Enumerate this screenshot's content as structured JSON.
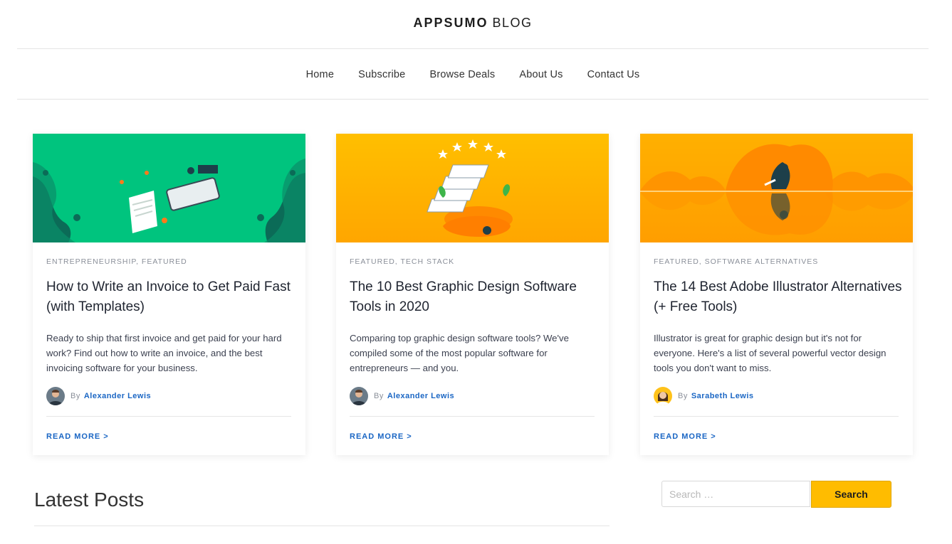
{
  "header": {
    "brand": "APPSUMO",
    "blog": "BLOG"
  },
  "nav": {
    "items": [
      {
        "label": "Home"
      },
      {
        "label": "Subscribe"
      },
      {
        "label": "Browse Deals"
      },
      {
        "label": "About Us"
      },
      {
        "label": "Contact Us"
      }
    ]
  },
  "colors": {
    "accent_link": "#1a66c4",
    "search_button": "#ffbc00",
    "card1_bg": "#00c47e",
    "card2_bg": "#ffb800",
    "card3_bg": "#ffa800"
  },
  "cards": [
    {
      "categories": "ENTREPRENEURSHIP, FEATURED",
      "title": "How to Write an Invoice to Get Paid Fast (with Templates)",
      "excerpt": "Ready to ship that first invoice and get paid for your hard work? Find out how to write an invoice, and the best invoicing software for your business.",
      "by": "By",
      "author": "Alexander Lewis",
      "read_more": "READ MORE >"
    },
    {
      "categories": "FEATURED, TECH STACK",
      "title": "The 10 Best Graphic Design Software Tools in 2020",
      "excerpt": "Comparing top graphic design software tools? We've compiled some of the most popular software for entrepreneurs — and you.",
      "by": "By",
      "author": "Alexander Lewis",
      "read_more": "READ MORE >"
    },
    {
      "categories": "FEATURED, SOFTWARE ALTERNATIVES",
      "title": "The 14 Best Adobe Illustrator Alternatives (+ Free Tools)",
      "excerpt": "Illustrator is great for graphic design but it's not for everyone. Here's a list of several powerful vector design tools you don't want to miss.",
      "by": "By",
      "author": "Sarabeth Lewis",
      "read_more": "READ MORE >"
    }
  ],
  "latest": {
    "heading": "Latest Posts"
  },
  "search": {
    "placeholder": "Search …",
    "button_label": "Search"
  }
}
